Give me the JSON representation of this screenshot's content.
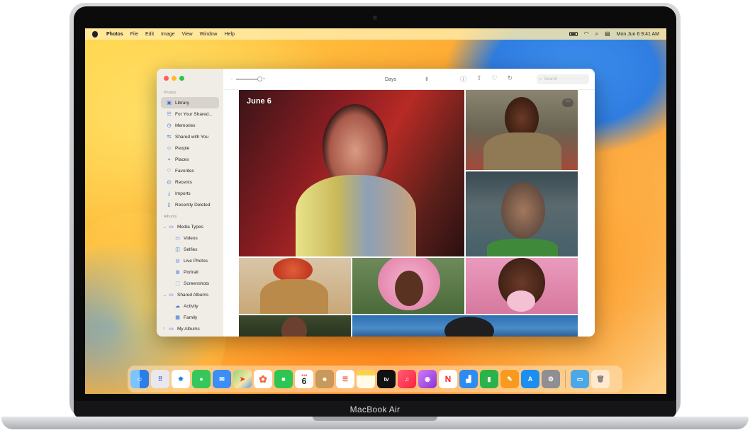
{
  "device": {
    "model_label": "MacBook Air"
  },
  "menubar": {
    "app_name": "Photos",
    "menus": [
      "File",
      "Edit",
      "Image",
      "View",
      "Window",
      "Help"
    ],
    "clock": "Mon Jun 6  9:41 AM"
  },
  "window": {
    "toolbar": {
      "view_selector": "Days",
      "search_placeholder": "Search"
    },
    "sidebar": {
      "photos_section": "Photos",
      "photos_items": [
        {
          "label": "Library",
          "icon": "library-icon"
        },
        {
          "label": "For Your Shared...",
          "icon": "people-icon"
        },
        {
          "label": "Memories",
          "icon": "memories-icon"
        },
        {
          "label": "Shared with You",
          "icon": "shared-icon"
        },
        {
          "label": "People",
          "icon": "person-icon"
        },
        {
          "label": "Places",
          "icon": "pin-icon"
        },
        {
          "label": "Favorites",
          "icon": "heart-icon"
        },
        {
          "label": "Recents",
          "icon": "clock-icon"
        },
        {
          "label": "Imports",
          "icon": "import-icon"
        },
        {
          "label": "Recently Deleted",
          "icon": "trash-icon"
        }
      ],
      "albums_section": "Albums",
      "media_types_label": "Media Types",
      "media_types_items": [
        {
          "label": "Videos",
          "icon": "video-icon"
        },
        {
          "label": "Selfies",
          "icon": "selfie-icon"
        },
        {
          "label": "Live Photos",
          "icon": "live-photo-icon"
        },
        {
          "label": "Portrait",
          "icon": "portrait-icon"
        },
        {
          "label": "Screenshots",
          "icon": "screenshot-icon"
        }
      ],
      "shared_albums_label": "Shared Albums",
      "shared_albums_items": [
        {
          "label": "Activity",
          "icon": "activity-icon"
        },
        {
          "label": "Family",
          "icon": "family-icon"
        }
      ],
      "my_albums_label": "My Albums"
    },
    "library": {
      "date_heading": "June 6"
    }
  },
  "dock": {
    "apps": [
      "Finder",
      "Launchpad",
      "Safari",
      "Messages",
      "Mail",
      "Maps",
      "Photos",
      "FaceTime",
      "Calendar",
      "Contacts",
      "Reminders",
      "Notes",
      "TV",
      "Music",
      "Podcasts",
      "News",
      "Keynote",
      "Numbers",
      "Pages",
      "App Store",
      "System Settings",
      "Downloads",
      "Trash"
    ],
    "calendar_day": "6",
    "tv_label": "tv"
  },
  "colors": {
    "accent": "#2f6fe0",
    "sidebar_bg": "#f0ece6",
    "wallpaper_primary": "#ffb237"
  }
}
